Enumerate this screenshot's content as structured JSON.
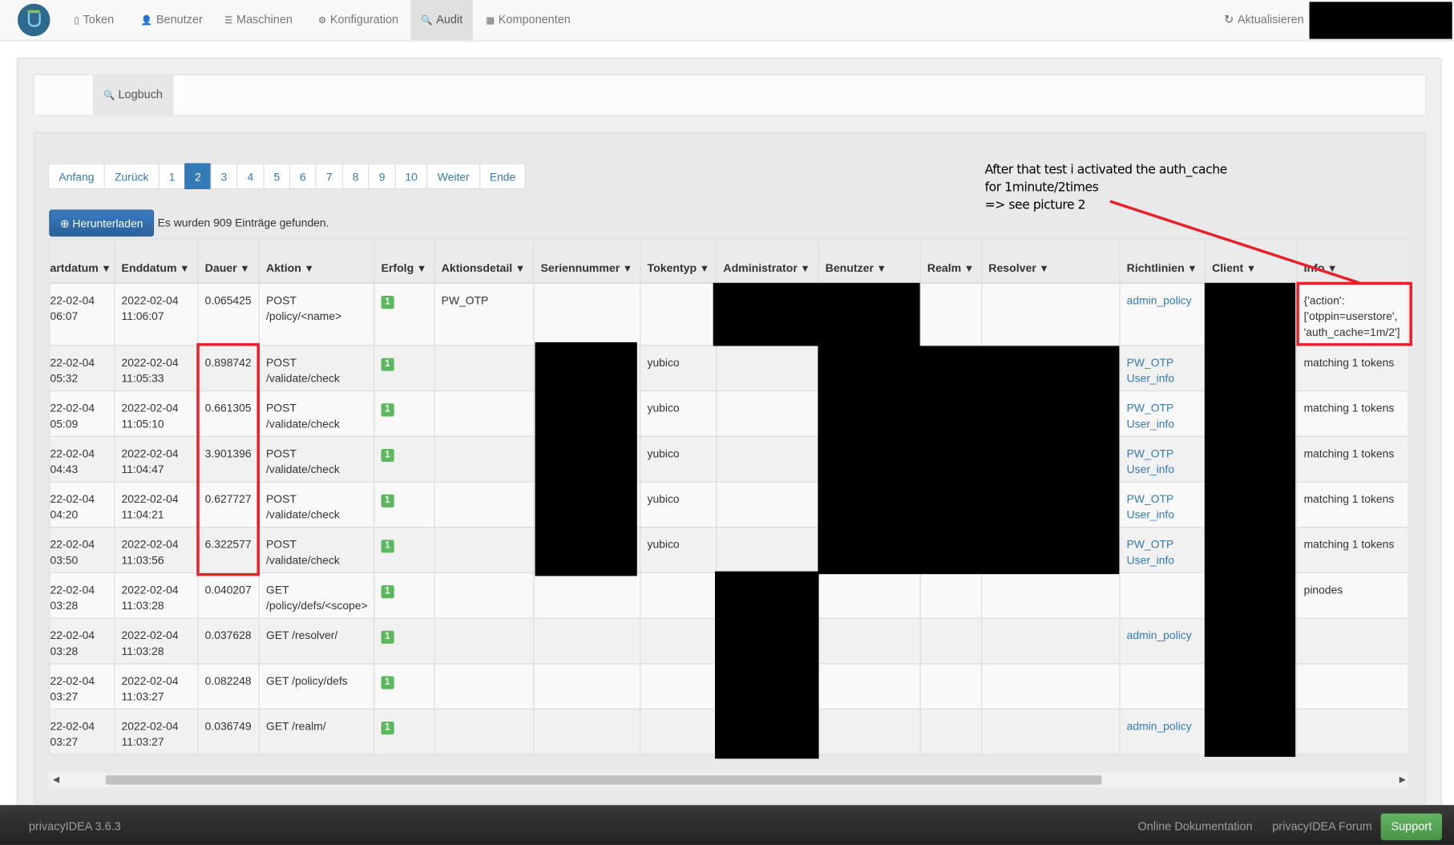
{
  "nav": {
    "items": [
      {
        "label": "Token",
        "icon": "mobile-icon",
        "glyph": "▯"
      },
      {
        "label": "Benutzer",
        "icon": "user-icon",
        "glyph": "👤"
      },
      {
        "label": "Maschinen",
        "icon": "server-icon",
        "glyph": "☰"
      },
      {
        "label": "Konfiguration",
        "icon": "gear-icon",
        "glyph": "⚙"
      },
      {
        "label": "Audit",
        "icon": "search-icon",
        "glyph": "🔍",
        "active": true
      },
      {
        "label": "Komponenten",
        "icon": "calendar-icon",
        "glyph": "▦"
      }
    ],
    "refresh_label": "Aktualisieren",
    "refresh_glyph": "↻"
  },
  "tabs": {
    "logbuch": "Logbuch",
    "glyph": "🔍"
  },
  "pagination": [
    "Anfang",
    "Zurück",
    "1",
    "2",
    "3",
    "4",
    "5",
    "6",
    "7",
    "8",
    "9",
    "10",
    "Weiter",
    "Ende"
  ],
  "pagination_active": "2",
  "download_label": "Herunterladen",
  "download_glyph": "⊕",
  "found_text": "Es wurden 909 Einträge gefunden.",
  "annotation": [
    "After that test i activated the auth_cache",
    "for 1minute/2times",
    "=> see picture 2"
  ],
  "colors": {
    "accent": "#337ab7",
    "success": "#5cb85c",
    "annotation_red": "#e8202a",
    "footer": "#2b2b2b"
  },
  "table": {
    "headers": [
      "artdatum",
      "Enddatum",
      "Dauer",
      "Aktion",
      "Erfolg",
      "Aktionsdetail",
      "Seriennummer",
      "Tokentyp",
      "Administrator",
      "Benutzer",
      "Realm",
      "Resolver",
      "Richtlinien",
      "Client",
      "Info"
    ],
    "filter_icon": "filter-icon",
    "rows": [
      {
        "start": [
          "22-02-04",
          "06:07"
        ],
        "end": [
          "2022-02-04",
          "11:06:07"
        ],
        "duration": "0.065425",
        "action": [
          "POST",
          "/policy/<name>"
        ],
        "success": "1",
        "detail": "PW_OTP",
        "tokentype": "",
        "policies": [
          "admin_policy"
        ],
        "info": [
          "{'action':",
          "['otppin=userstore',",
          "'auth_cache=1m/2']"
        ]
      },
      {
        "start": [
          "22-02-04",
          "05:32"
        ],
        "end": [
          "2022-02-04",
          "11:05:33"
        ],
        "duration": "0.898742",
        "action": [
          "POST",
          "/validate/check"
        ],
        "success": "1",
        "detail": "",
        "tokentype": "yubico",
        "policies": [
          "PW_OTP",
          "User_info"
        ],
        "info": [
          "matching 1 tokens"
        ]
      },
      {
        "start": [
          "22-02-04",
          "05:09"
        ],
        "end": [
          "2022-02-04",
          "11:05:10"
        ],
        "duration": "0.661305",
        "action": [
          "POST",
          "/validate/check"
        ],
        "success": "1",
        "detail": "",
        "tokentype": "yubico",
        "policies": [
          "PW_OTP",
          "User_info"
        ],
        "info": [
          "matching 1 tokens"
        ]
      },
      {
        "start": [
          "22-02-04",
          "04:43"
        ],
        "end": [
          "2022-02-04",
          "11:04:47"
        ],
        "duration": "3.901396",
        "action": [
          "POST",
          "/validate/check"
        ],
        "success": "1",
        "detail": "",
        "tokentype": "yubico",
        "policies": [
          "PW_OTP",
          "User_info"
        ],
        "info": [
          "matching 1 tokens"
        ]
      },
      {
        "start": [
          "22-02-04",
          "04:20"
        ],
        "end": [
          "2022-02-04",
          "11:04:21"
        ],
        "duration": "0.627727",
        "action": [
          "POST",
          "/validate/check"
        ],
        "success": "1",
        "detail": "",
        "tokentype": "yubico",
        "policies": [
          "PW_OTP",
          "User_info"
        ],
        "info": [
          "matching 1 tokens"
        ]
      },
      {
        "start": [
          "22-02-04",
          "03:50"
        ],
        "end": [
          "2022-02-04",
          "11:03:56"
        ],
        "duration": "6.322577",
        "action": [
          "POST",
          "/validate/check"
        ],
        "success": "1",
        "detail": "",
        "tokentype": "yubico",
        "policies": [
          "PW_OTP",
          "User_info"
        ],
        "info": [
          "matching 1 tokens"
        ]
      },
      {
        "start": [
          "22-02-04",
          "03:28"
        ],
        "end": [
          "2022-02-04",
          "11:03:28"
        ],
        "duration": "0.040207",
        "action": [
          "GET",
          "/policy/defs/<scope>"
        ],
        "success": "1",
        "detail": "",
        "tokentype": "",
        "policies": [],
        "info": [
          "pinodes"
        ]
      },
      {
        "start": [
          "22-02-04",
          "03:28"
        ],
        "end": [
          "2022-02-04",
          "11:03:28"
        ],
        "duration": "0.037628",
        "action": [
          "GET /resolver/"
        ],
        "success": "1",
        "detail": "",
        "tokentype": "",
        "policies": [
          "admin_policy"
        ],
        "info": []
      },
      {
        "start": [
          "22-02-04",
          "03:27"
        ],
        "end": [
          "2022-02-04",
          "11:03:27"
        ],
        "duration": "0.082248",
        "action": [
          "GET /policy/defs"
        ],
        "success": "1",
        "detail": "",
        "tokentype": "",
        "policies": [],
        "info": []
      },
      {
        "start": [
          "22-02-04",
          "03:27"
        ],
        "end": [
          "2022-02-04",
          "11:03:27"
        ],
        "duration": "0.036749",
        "action": [
          "GET /realm/"
        ],
        "success": "1",
        "detail": "",
        "tokentype": "",
        "policies": [
          "admin_policy"
        ],
        "info": []
      }
    ]
  },
  "footer": {
    "version": "privacyIDEA 3.6.3",
    "docs": "Online Dokumentation",
    "forum": "privacyIDEA Forum",
    "support": "Support"
  }
}
